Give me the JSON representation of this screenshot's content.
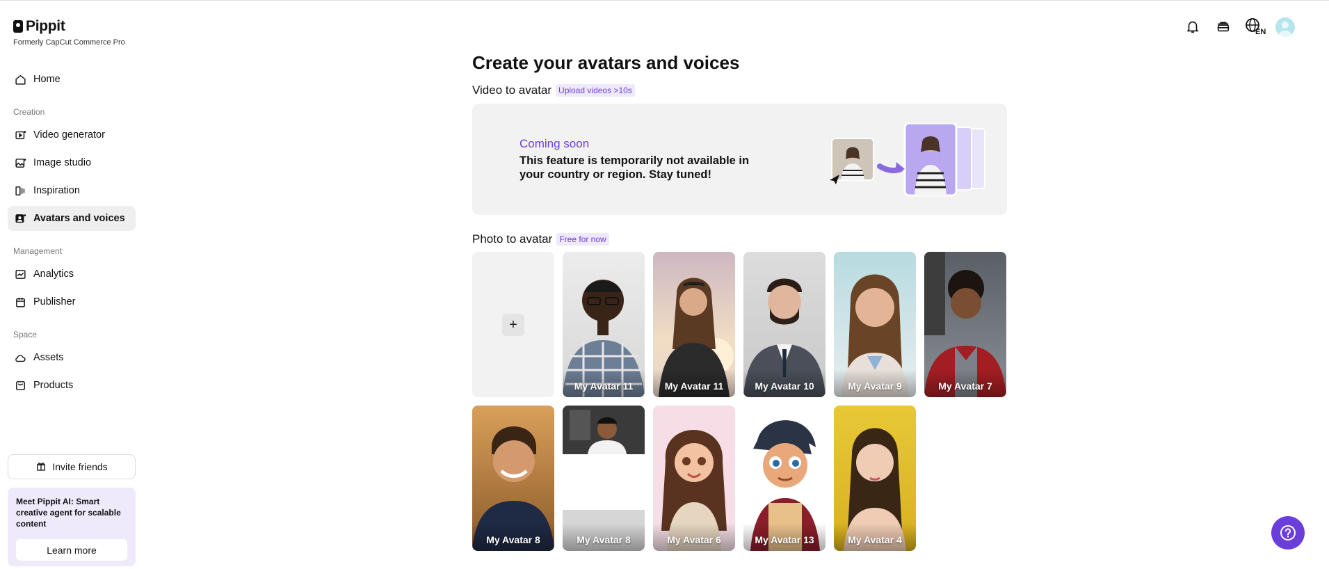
{
  "brand": {
    "name": "Pippit",
    "subtitle": "Formerly CapCut Commerce Pro"
  },
  "sidebar": {
    "home": "Home",
    "sections": [
      "Creation",
      "Management",
      "Space"
    ],
    "creation": [
      "Video generator",
      "Image studio",
      "Inspiration",
      "Avatars and voices"
    ],
    "management": [
      "Analytics",
      "Publisher"
    ],
    "space": [
      "Assets",
      "Products"
    ],
    "invite_label": "Invite friends",
    "promo_text": "Meet Pippit AI: Smart creative agent for scalable content",
    "promo_button": "Learn more"
  },
  "header": {
    "language": "EN"
  },
  "main": {
    "title": "Create your avatars and voices",
    "video_section": {
      "title": "Video to avatar",
      "badge": "Upload videos >10s"
    },
    "coming_soon": {
      "title": "Coming soon",
      "body": "This feature is temporarily not available in your country or region. Stay tuned!"
    },
    "photo_section": {
      "title": "Photo to avatar",
      "badge": "Free for now"
    },
    "add_symbol": "+",
    "avatars": [
      "My Avatar 11",
      "My Avatar 11",
      "My Avatar 10",
      "My Avatar 9",
      "My Avatar 7",
      "My Avatar 8",
      "My Avatar 8",
      "My Avatar 6",
      "My Avatar 13",
      "My Avatar 4"
    ]
  },
  "colors": {
    "accent": "#6a3fd9",
    "accent_bg": "#efe9fc",
    "card_bg": "#f2f2f2"
  }
}
